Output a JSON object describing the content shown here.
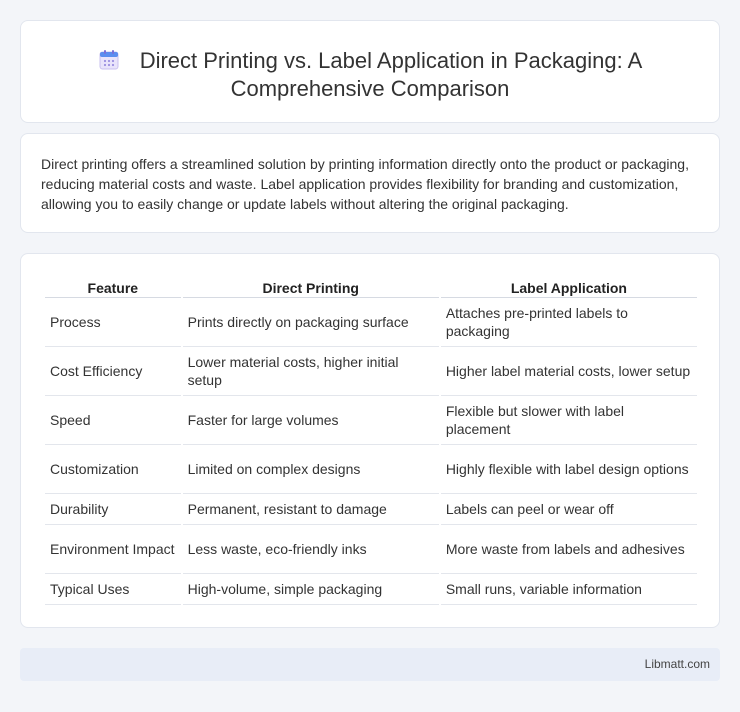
{
  "header": {
    "icon": "calendar-icon",
    "title": "Direct Printing vs. Label Application in Packaging: A Comprehensive Comparison"
  },
  "intro": {
    "text": "Direct printing offers a streamlined solution by printing information directly onto the product or packaging, reducing material costs and waste. Label application provides flexibility for branding and customization, allowing you to easily change or update labels without altering the original packaging."
  },
  "table": {
    "headers": [
      "Feature",
      "Direct Printing",
      "Label Application"
    ],
    "rows": [
      [
        "Process",
        "Prints directly on packaging surface",
        "Attaches pre-printed labels to packaging"
      ],
      [
        "Cost Efficiency",
        "Lower material costs, higher initial setup",
        "Higher label material costs, lower setup"
      ],
      [
        "Speed",
        "Faster for large volumes",
        "Flexible but slower with label placement"
      ],
      [
        "Customization",
        "Limited on complex designs",
        "Highly flexible with label design options"
      ],
      [
        "Durability",
        "Permanent, resistant to damage",
        "Labels can peel or wear off"
      ],
      [
        "Environment Impact",
        "Less waste, eco-friendly inks",
        "More waste from labels and adhesives"
      ],
      [
        "Typical Uses",
        "High-volume, simple packaging",
        "Small runs, variable information"
      ]
    ]
  },
  "footer": {
    "text": "Libmatt.com"
  }
}
